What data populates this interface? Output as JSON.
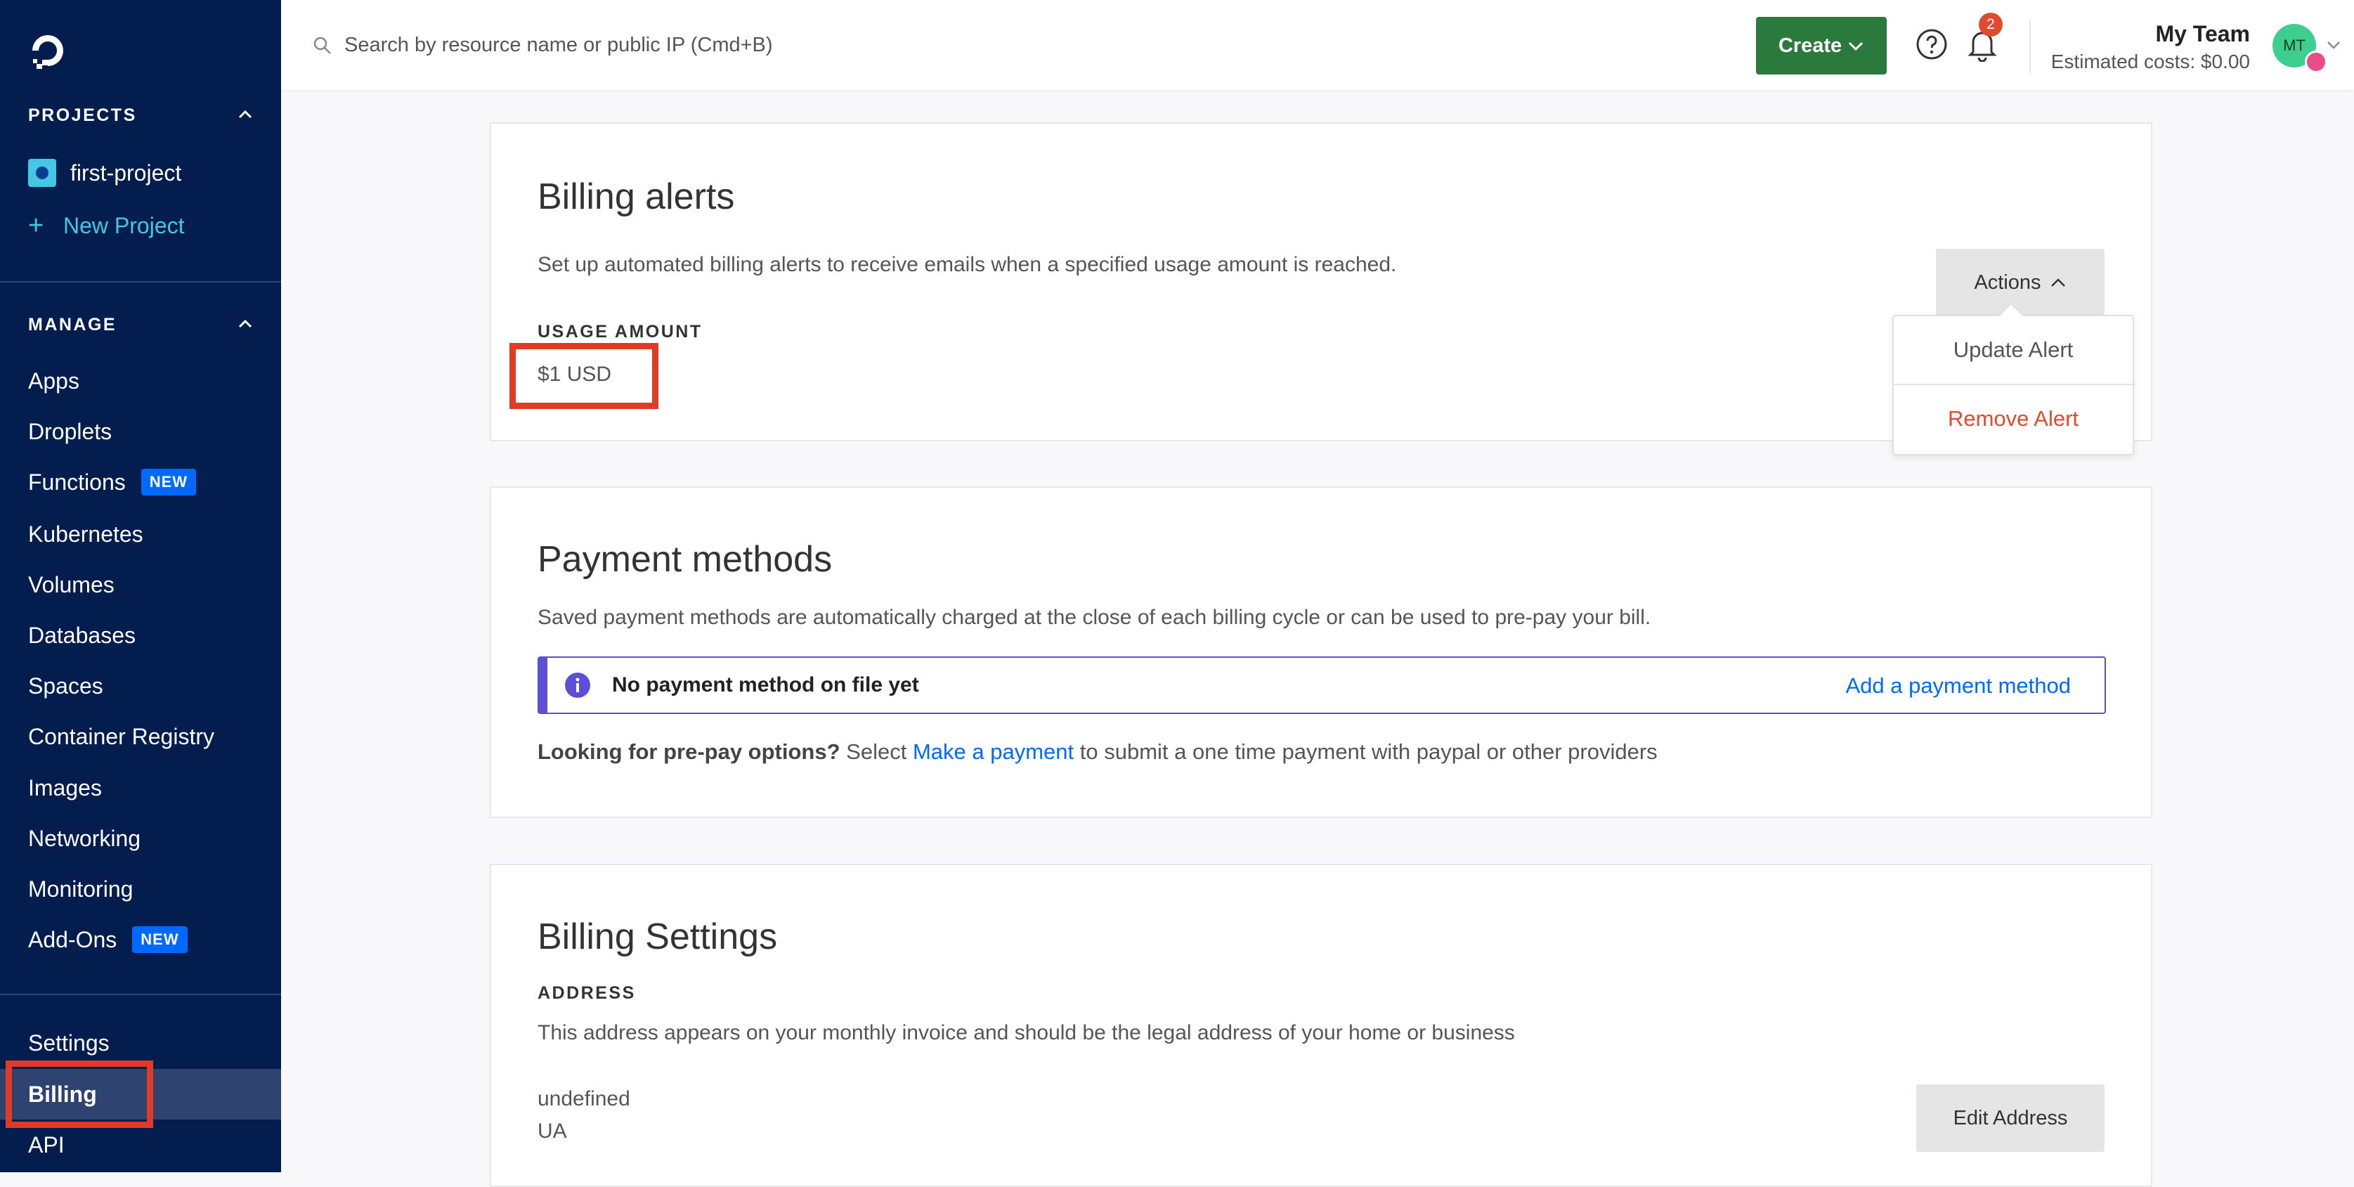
{
  "sidebar": {
    "logo": "digitalocean-logo-icon",
    "projects_heading": "PROJECTS",
    "projects": [
      {
        "label": "first-project"
      }
    ],
    "new_project_label": "New Project",
    "manage_heading": "MANAGE",
    "nav": [
      {
        "label": "Apps"
      },
      {
        "label": "Droplets"
      },
      {
        "label": "Functions",
        "badge": "NEW"
      },
      {
        "label": "Kubernetes"
      },
      {
        "label": "Volumes"
      },
      {
        "label": "Databases"
      },
      {
        "label": "Spaces"
      },
      {
        "label": "Container Registry"
      },
      {
        "label": "Images"
      },
      {
        "label": "Networking"
      },
      {
        "label": "Monitoring"
      },
      {
        "label": "Add-Ons",
        "badge": "NEW"
      }
    ],
    "bottom_nav": [
      {
        "label": "Settings"
      },
      {
        "label": "Billing",
        "active": true
      },
      {
        "label": "API"
      }
    ]
  },
  "topbar": {
    "search_placeholder": "Search by resource name or public IP (Cmd+B)",
    "create_label": "Create",
    "notification_count": "2",
    "team_name": "My Team",
    "estimated_costs": "Estimated costs: $0.00",
    "avatar_initials": "MT"
  },
  "billing_alerts": {
    "title": "Billing alerts",
    "description": "Set up automated billing alerts to receive emails when a specified usage amount is reached.",
    "usage_label": "USAGE AMOUNT",
    "usage_value": "$1 USD",
    "actions_label": "Actions",
    "menu": {
      "update": "Update Alert",
      "remove": "Remove Alert"
    }
  },
  "payment_methods": {
    "title": "Payment methods",
    "description": "Saved payment methods are automatically charged at the close of each billing cycle or can be used to pre-pay your bill.",
    "notice_text": "No payment method on file yet",
    "notice_link": "Add a payment method",
    "prepay_bold": "Looking for pre-pay options?",
    "prepay_pre": "Select",
    "prepay_link": "Make a payment",
    "prepay_post": "to submit a one time payment with paypal or other providers"
  },
  "billing_settings": {
    "title": "Billing Settings",
    "address_label": "ADDRESS",
    "address_desc": "This address appears on your monthly invoice and should be the legal address of your home or business",
    "address_line1": "undefined",
    "address_line2": "UA",
    "edit_label": "Edit Address"
  },
  "colors": {
    "sidebar_bg": "#041d4f",
    "accent_blue": "#0069ff",
    "create_green": "#2b7a3d",
    "danger_red": "#e2492f",
    "highlight_red": "#e13a25"
  }
}
